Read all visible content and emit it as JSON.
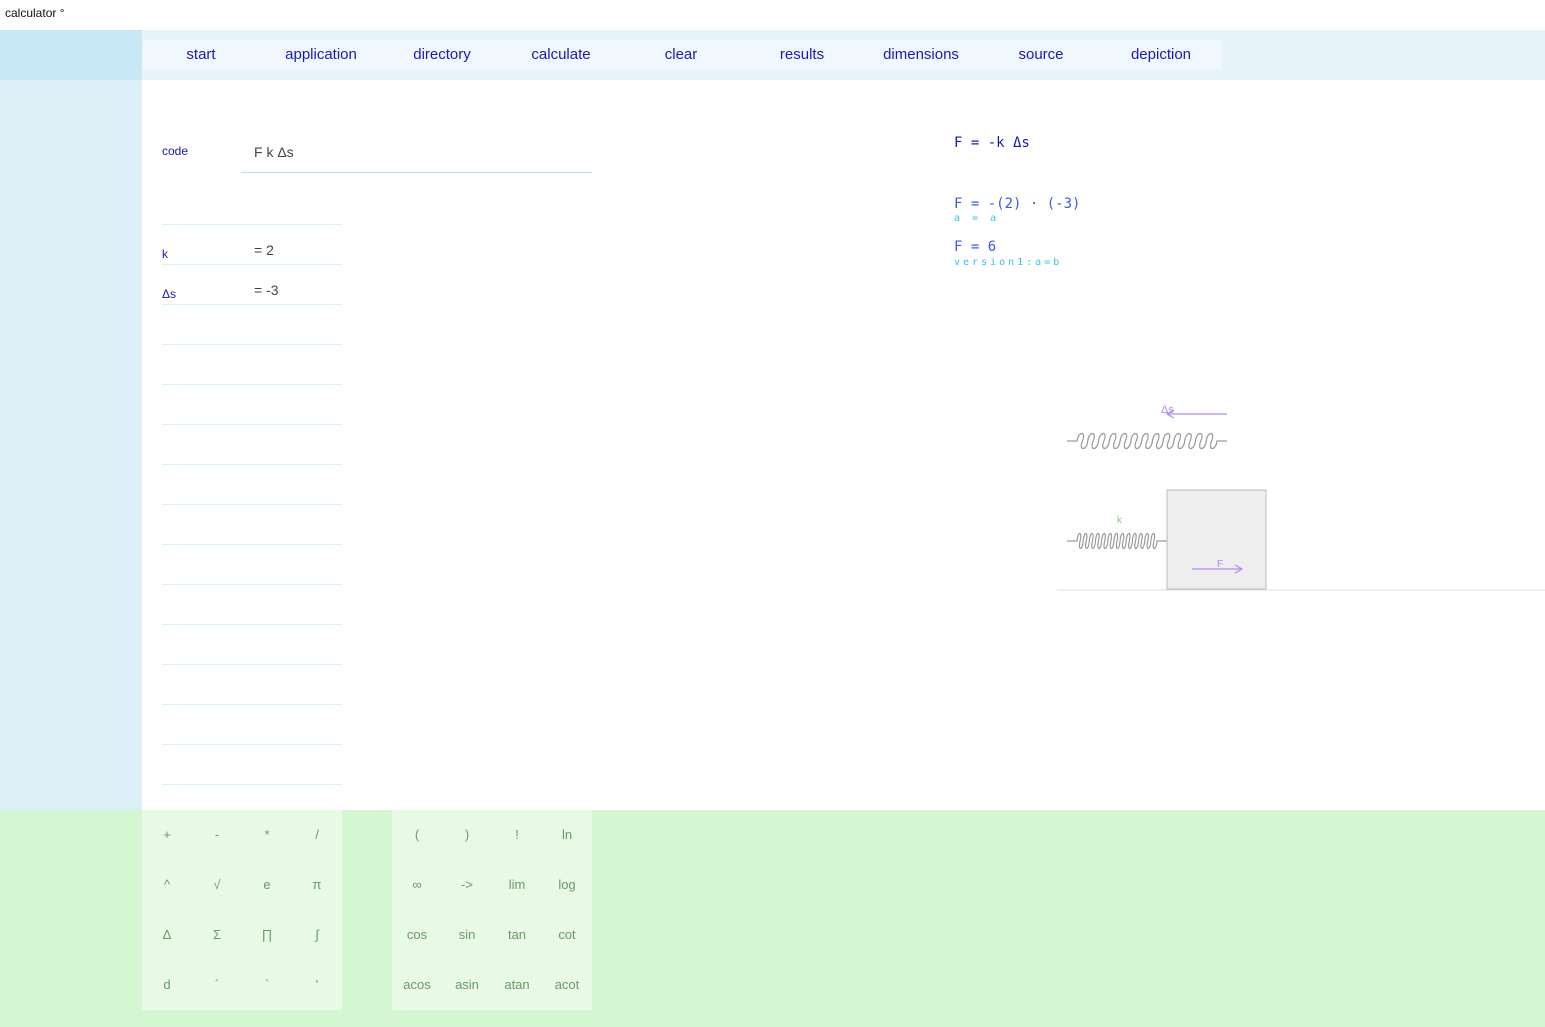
{
  "window": {
    "title": "calculator °"
  },
  "nav": {
    "items": [
      "start",
      "application",
      "directory",
      "calculate",
      "clear",
      "results",
      "dimensions",
      "source",
      "depiction"
    ]
  },
  "input": {
    "label": "code",
    "value": "F k Δs"
  },
  "variables": [
    {
      "name": "k",
      "value": "=  2"
    },
    {
      "name": "Δs",
      "value": "=  -3"
    }
  ],
  "output": {
    "formula": "F = -k Δs",
    "substituted": "F = -(2) · (-3)",
    "note1": "a = a",
    "result": "F = 6",
    "note2": "version1:a=b"
  },
  "diagram": {
    "label_ds": "Δs",
    "label_k": "k",
    "label_f": "F"
  },
  "keypad": {
    "basic": [
      "+",
      "-",
      "*",
      "/",
      "^",
      "√",
      "e",
      "π",
      "Δ",
      "Σ",
      "∏",
      "∫",
      "d",
      "´",
      "`",
      "'"
    ],
    "functions": [
      "(",
      ")",
      "!",
      "ln",
      "∞",
      "->",
      "lim",
      "log",
      "cos",
      "sin",
      "tan",
      "cot",
      "acos",
      "asin",
      "atan",
      "acot"
    ]
  }
}
